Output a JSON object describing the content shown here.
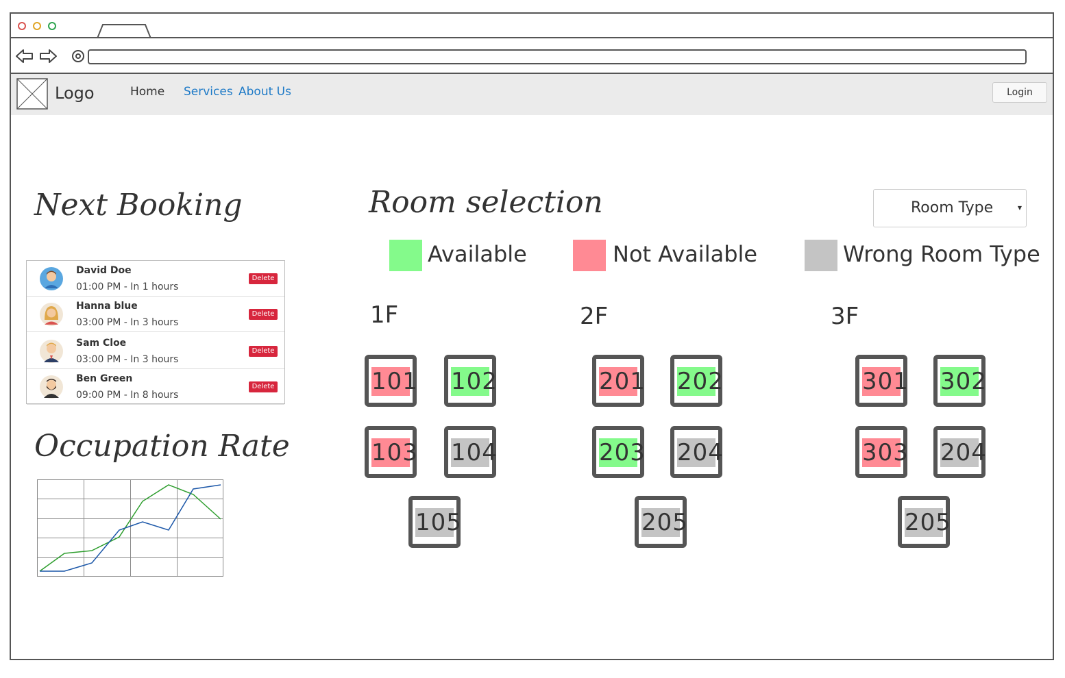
{
  "nav": {
    "logo": "Logo",
    "home": "Home",
    "services": "Services",
    "about": "About Us",
    "login": "Login"
  },
  "bookings": {
    "title": "Next Booking",
    "delete_label": "Delete",
    "items": [
      {
        "name": "David Doe",
        "time": "01:00 PM - In 1 hours",
        "avatar": "avatar-man-blue"
      },
      {
        "name": "Hanna blue",
        "time": "03:00 PM - In 3 hours",
        "avatar": "avatar-woman-blonde"
      },
      {
        "name": "Sam Cloe",
        "time": "03:00 PM - In 3 hours",
        "avatar": "avatar-man-suit"
      },
      {
        "name": "Ben Green",
        "time": "09:00 PM - In 8 hours",
        "avatar": "avatar-man-beard"
      }
    ]
  },
  "occupation": {
    "title": "Occupation Rate"
  },
  "chart_data": {
    "type": "line",
    "title": "",
    "xlabel": "",
    "ylabel": "",
    "grid": true,
    "x": [
      0,
      1,
      2,
      3,
      4,
      5,
      6,
      7
    ],
    "series": [
      {
        "values": [
          0,
          25,
          38,
          95,
          130,
          112,
          208,
          208
        ],
        "color": "#1a56a8"
      },
      {
        "values": [
          0,
          25,
          38,
          95,
          130,
          112,
          208,
          208
        ],
        "color": "#2e9e2e"
      }
    ]
  },
  "room_selection": {
    "title": "Room selection",
    "room_type_label": "Room Type",
    "legend": [
      {
        "label": "Available",
        "color": "#84fa8b"
      },
      {
        "label": "Not Available",
        "color": "#ff8a94"
      },
      {
        "label": "Wrong Room Type",
        "color": "#c4c4c4"
      }
    ],
    "floors": [
      {
        "label": "1F",
        "rooms": [
          {
            "number": "101",
            "status": "notavail"
          },
          {
            "number": "102",
            "status": "available"
          },
          {
            "number": "103",
            "status": "notavail"
          },
          {
            "number": "104",
            "status": "wrong"
          },
          {
            "number": "105",
            "status": "wrong"
          }
        ]
      },
      {
        "label": "2F",
        "rooms": [
          {
            "number": "201",
            "status": "notavail"
          },
          {
            "number": "202",
            "status": "available"
          },
          {
            "number": "203",
            "status": "available"
          },
          {
            "number": "204",
            "status": "wrong"
          },
          {
            "number": "205",
            "status": "wrong"
          }
        ]
      },
      {
        "label": "3F",
        "rooms": [
          {
            "number": "301",
            "status": "notavail"
          },
          {
            "number": "302",
            "status": "available"
          },
          {
            "number": "303",
            "status": "notavail"
          },
          {
            "number": "204",
            "status": "wrong"
          },
          {
            "number": "205",
            "status": "wrong"
          }
        ]
      }
    ]
  }
}
